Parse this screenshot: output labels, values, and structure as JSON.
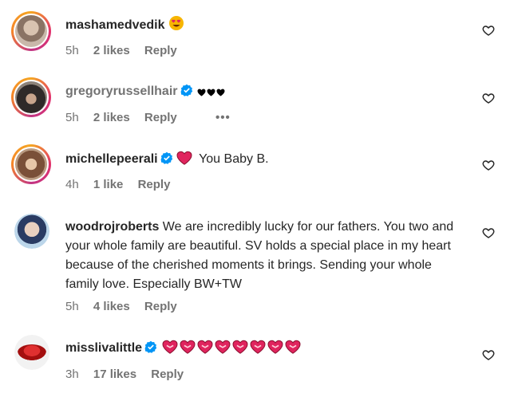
{
  "comments": [
    {
      "username": "mashamedvedik",
      "verified": false,
      "text": "",
      "emoji": "heart-eyes-emoji",
      "time": "5h",
      "likes": "2 likes",
      "reply": "Reply"
    },
    {
      "username": "gregoryrussellhair",
      "verified": true,
      "text": "",
      "emoji": "black-hearts",
      "time": "5h",
      "likes": "2 likes",
      "reply": "Reply",
      "more": "•••"
    },
    {
      "username": "michellepeerali",
      "verified": true,
      "text": "You Baby B.",
      "emoji": "red-heart",
      "time": "4h",
      "likes": "1 like",
      "reply": "Reply"
    },
    {
      "username": "woodrojroberts",
      "verified": false,
      "text": "We are incredibly lucky for our fathers. You two and your whole family are beautiful. SV holds a special place in my heart because of the cherished moments it brings. Sending your whole family love. Especially BW+TW",
      "time": "5h",
      "likes": "4 likes",
      "reply": "Reply"
    },
    {
      "username": "misslivalittle",
      "verified": true,
      "text": "",
      "emoji": "heart-with-ribbon-x8",
      "time": "3h",
      "likes": "17 likes",
      "reply": "Reply"
    }
  ],
  "colors": {
    "text": "#262626",
    "muted": "#737373",
    "verified": "#0095f6",
    "heart_red": "#e0245e"
  }
}
